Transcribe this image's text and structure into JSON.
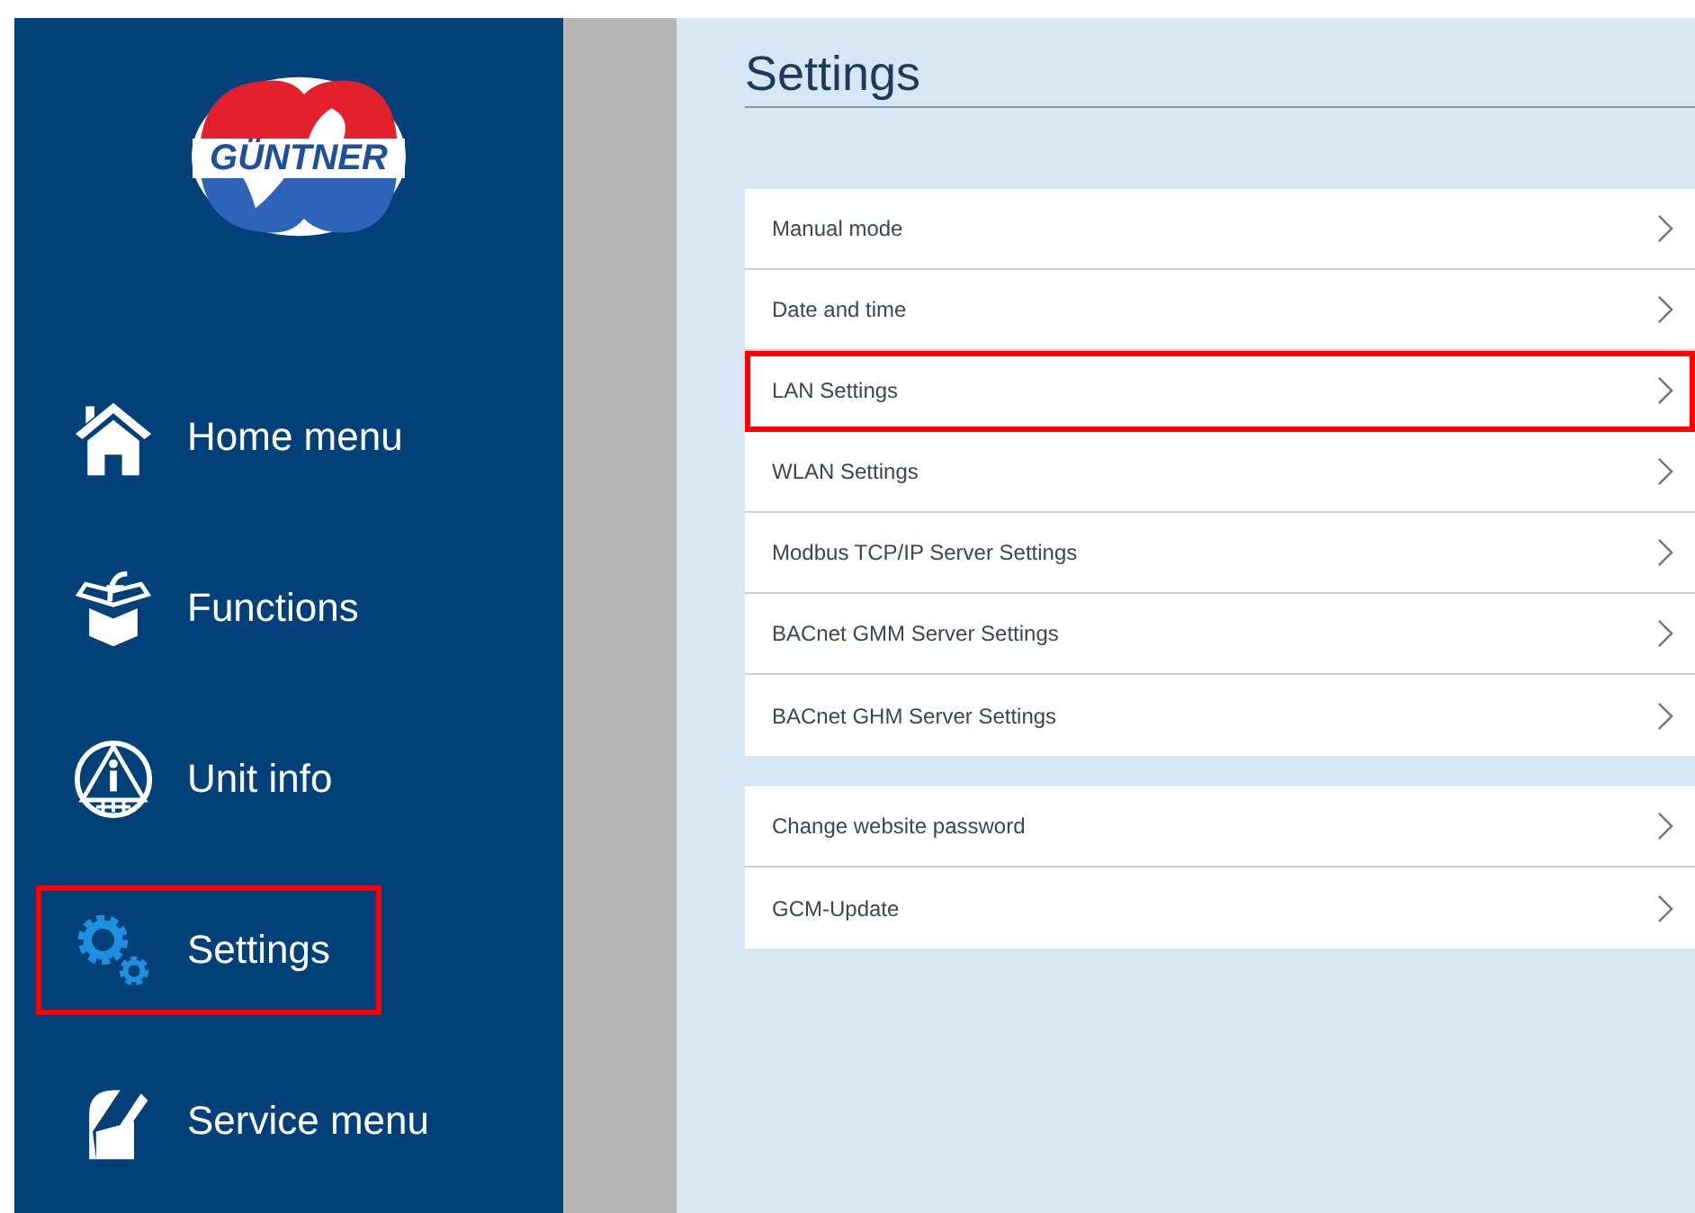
{
  "logo": {
    "text": "GÜNTNER"
  },
  "sidebar": {
    "items": [
      {
        "label": "Home menu",
        "kind": "home",
        "selected": false,
        "highlighted": false
      },
      {
        "label": "Functions",
        "kind": "functions",
        "selected": false,
        "highlighted": false
      },
      {
        "label": "Unit info",
        "kind": "info",
        "selected": false,
        "highlighted": false
      },
      {
        "label": "Settings",
        "kind": "gears",
        "selected": true,
        "highlighted": true
      },
      {
        "label": "Service menu",
        "kind": "service",
        "selected": false,
        "highlighted": false
      }
    ]
  },
  "page": {
    "title": "Settings",
    "groups": [
      {
        "items": [
          {
            "label": "Manual mode",
            "highlighted": false
          },
          {
            "label": "Date and time",
            "highlighted": false
          },
          {
            "label": "LAN Settings",
            "highlighted": true
          },
          {
            "label": "WLAN Settings",
            "highlighted": false
          },
          {
            "label": "Modbus TCP/IP Server Settings",
            "highlighted": false
          },
          {
            "label": "BACnet GMM Server Settings",
            "highlighted": false
          },
          {
            "label": "BACnet GHM Server Settings",
            "highlighted": false
          }
        ]
      },
      {
        "items": [
          {
            "label": "Change website password",
            "highlighted": false
          },
          {
            "label": "GCM-Update",
            "highlighted": false
          }
        ]
      }
    ]
  }
}
